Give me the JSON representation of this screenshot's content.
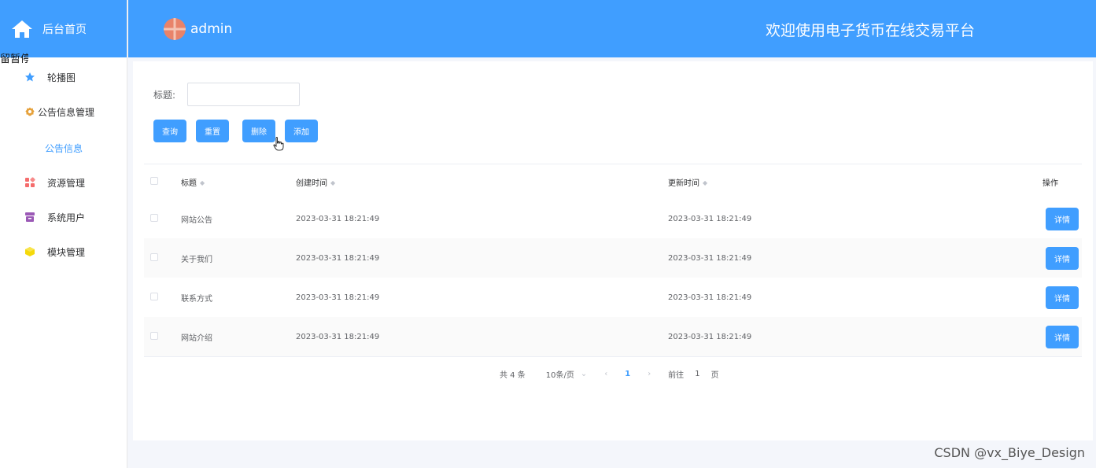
{
  "sidebar": {
    "home_label": "后台首页",
    "overlap_text": "留暂停",
    "items": [
      {
        "label": "轮播图",
        "icon": "star-icon",
        "color": "#409eff"
      },
      {
        "label": "公告信息管理",
        "icon": "badge-icon",
        "color": "#e6a23c"
      },
      {
        "label": "公告信息"
      },
      {
        "label": "资源管理",
        "icon": "grid-icon",
        "color": "#f56c6c"
      },
      {
        "label": "系统用户",
        "icon": "archive-icon",
        "color": "#9b59b6"
      },
      {
        "label": "模块管理",
        "icon": "cube-icon",
        "color": "#f5d90a"
      }
    ]
  },
  "topbar": {
    "admin_name": "admin",
    "site_title": "欢迎使用电子货币在线交易平台"
  },
  "search": {
    "label": "标题:",
    "placeholder": ""
  },
  "buttons": {
    "query": "查询",
    "reset": "重置",
    "delete": "删除",
    "add": "添加"
  },
  "table": {
    "headers": {
      "title": "标题",
      "created": "创建时间",
      "updated": "更新时间",
      "operation": "操作"
    },
    "rows": [
      {
        "title": "网站公告",
        "created": "2023-03-31 18:21:49",
        "updated": "2023-03-31 18:21:49",
        "action": "详情"
      },
      {
        "title": "关于我们",
        "created": "2023-03-31 18:21:49",
        "updated": "2023-03-31 18:21:49",
        "action": "详情"
      },
      {
        "title": "联系方式",
        "created": "2023-03-31 18:21:49",
        "updated": "2023-03-31 18:21:49",
        "action": "详情"
      },
      {
        "title": "网站介绍",
        "created": "2023-03-31 18:21:49",
        "updated": "2023-03-31 18:21:49",
        "action": "详情"
      }
    ]
  },
  "pager": {
    "total": "共 4 条",
    "page_size": "10条/页",
    "current_page": "1",
    "goto_label": "前往",
    "goto_value": "1",
    "page_suffix": "页"
  },
  "watermark": "CSDN @vx_Biye_Design",
  "colors": {
    "primary": "#409eff"
  }
}
